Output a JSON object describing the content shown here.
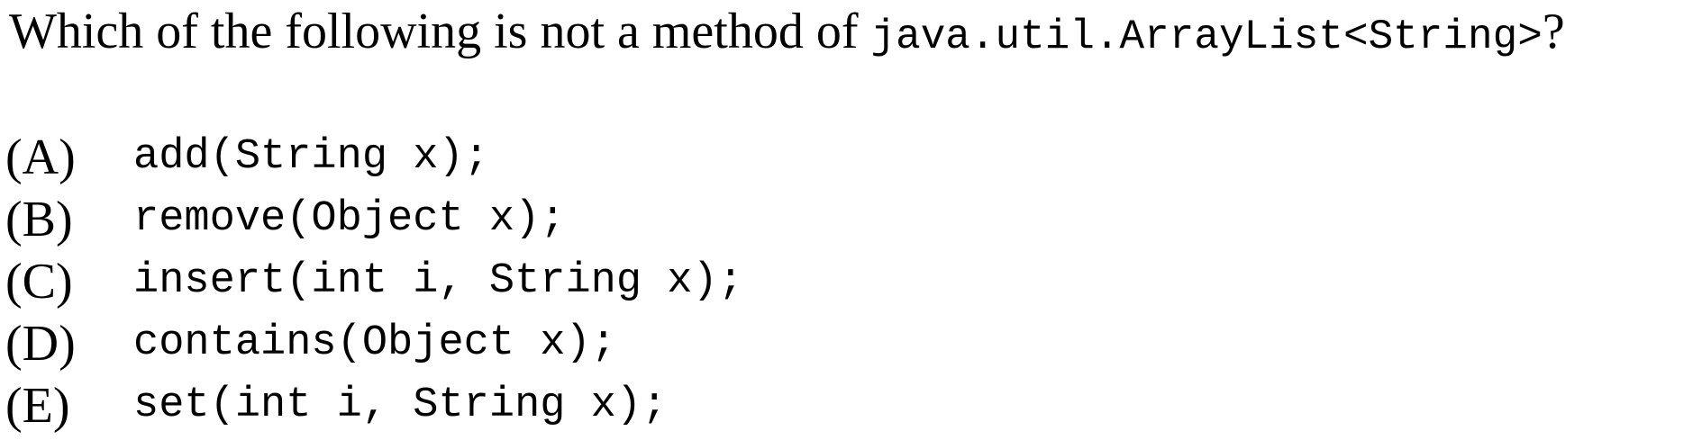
{
  "question": {
    "prefix": "Which of the following is not a method of ",
    "code": "java.util.ArrayList<String>",
    "suffix": "?"
  },
  "choices": [
    {
      "letter": "(A)",
      "code": "add(String x);"
    },
    {
      "letter": "(B)",
      "code": "remove(Object x);"
    },
    {
      "letter": "(C)",
      "code": "insert(int i, String x);"
    },
    {
      "letter": "(D)",
      "code": "contains(Object x);"
    },
    {
      "letter": "(E)",
      "code": "set(int i, String x);"
    }
  ]
}
